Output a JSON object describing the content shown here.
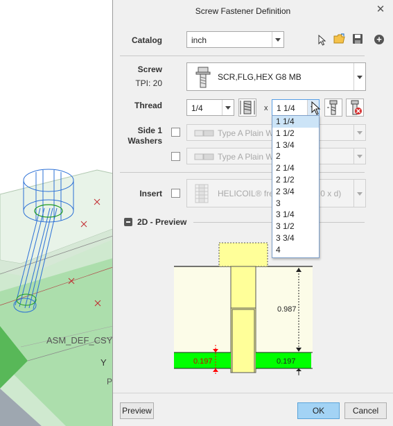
{
  "dialog": {
    "title": "Screw Fastener Definition",
    "close_icon": "close-icon"
  },
  "catalog": {
    "label": "Catalog",
    "value": "inch"
  },
  "screw": {
    "label": "Screw",
    "tpi": "TPI: 20",
    "value": "SCR,FLG,HEX G8 MB"
  },
  "thread": {
    "label": "Thread",
    "diameter": "1/4",
    "times": "x",
    "length": "1 1/4",
    "length_options": [
      "1 1/4",
      "1 1/2",
      "1 3/4",
      "2",
      "2 1/4",
      "2 1/2",
      "2 3/4",
      "3",
      "3 1/4",
      "3 1/2",
      "3 3/4",
      "4"
    ],
    "selected_index": 0
  },
  "washers": {
    "label_line1": "Side 1",
    "label_line2": "Washers",
    "washer1": "Type A Plain Washer (w)",
    "washer2": "Type A Plain Washer (w)"
  },
  "insert": {
    "label": "Insert",
    "value": "HELICOIL® free running (1.0 x d)"
  },
  "preview": {
    "header": "2D - Preview",
    "dim_length": "0.987",
    "dim_flange_left": "0.197",
    "dim_flange_right": "0.197",
    "colors": {
      "head": "#ffff99",
      "plate": "#00ff00",
      "bg": "#fcfce8"
    }
  },
  "buttons": {
    "preview": "Preview",
    "ok": "OK",
    "cancel": "Cancel"
  },
  "viewport": {
    "label_text": "ASM_DEF_CSYS",
    "label_y": "Y",
    "label_p": "P"
  }
}
